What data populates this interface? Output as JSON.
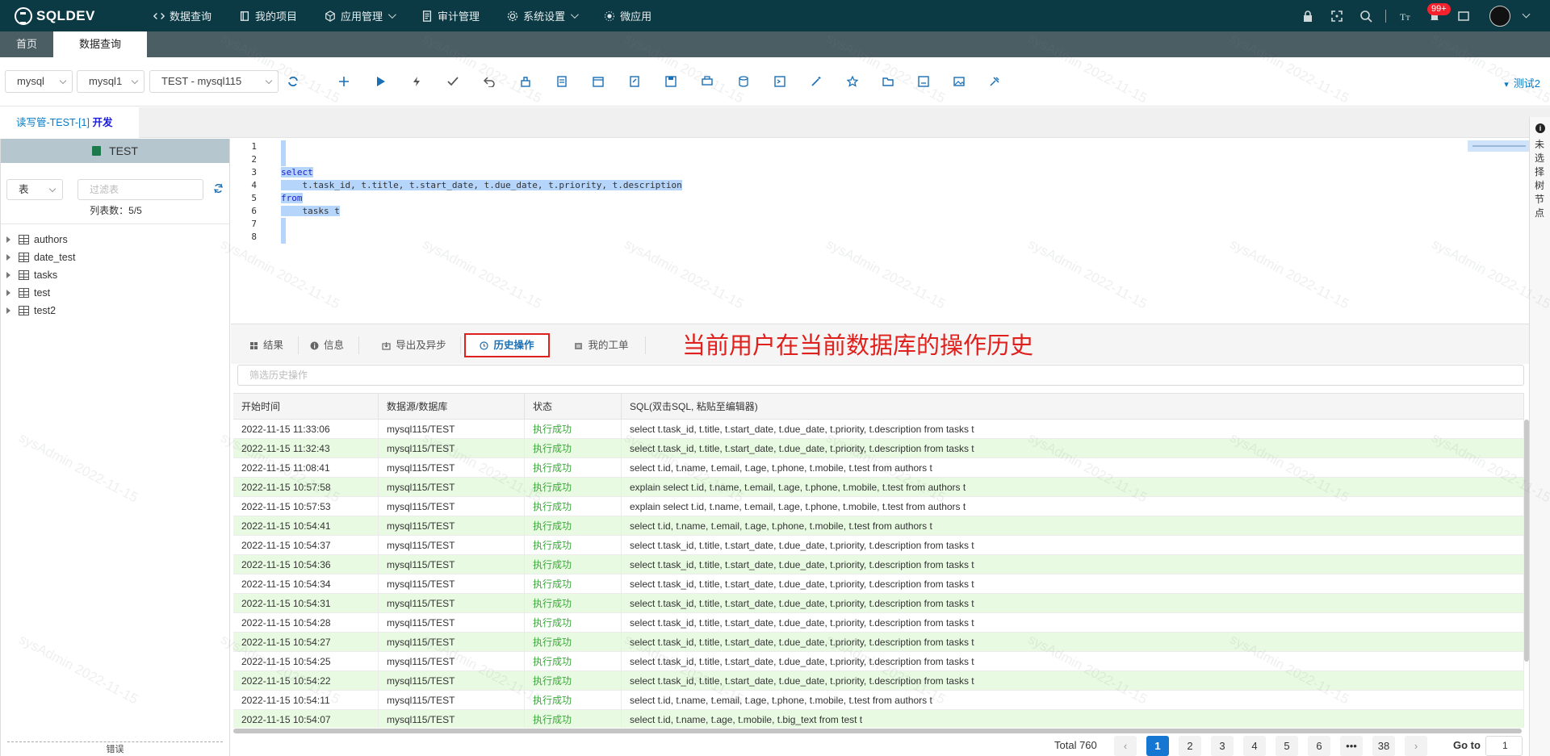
{
  "app": {
    "logo": "SQLDEV"
  },
  "nav": [
    {
      "label": "数据查询",
      "icon": "code-icon",
      "dropdown": false
    },
    {
      "label": "我的项目",
      "icon": "book-icon",
      "dropdown": false
    },
    {
      "label": "应用管理",
      "icon": "cube-icon",
      "dropdown": true
    },
    {
      "label": "审计管理",
      "icon": "document-icon",
      "dropdown": false
    },
    {
      "label": "系统设置",
      "icon": "gear-icon",
      "dropdown": true
    },
    {
      "label": "微应用",
      "icon": "sun-icon",
      "dropdown": false
    }
  ],
  "header_right": {
    "badge": "99+"
  },
  "page_tabs": [
    "首页",
    "数据查询"
  ],
  "toolbar": {
    "db_type": "mysql",
    "datasource": "mysql1",
    "connection": "TEST - mysql115",
    "user": "测试2"
  },
  "conn_tab": {
    "name": "读写管-TEST-[1]",
    "env": "开发"
  },
  "left_panel": {
    "db_name": "TEST",
    "kind": "表",
    "filter_placeholder": "过滤表",
    "count": "列表数：5/5",
    "tables": [
      "authors",
      "date_test",
      "tasks",
      "test",
      "test2"
    ],
    "footer": "错误"
  },
  "editor": {
    "lines": [
      {
        "num": "1",
        "text": ""
      },
      {
        "num": "2",
        "text": ""
      },
      {
        "num": "3",
        "text": "select"
      },
      {
        "num": "4",
        "text": "    t.task_id, t.title, t.start_date, t.due_date, t.priority, t.description"
      },
      {
        "num": "5",
        "text": "from"
      },
      {
        "num": "6",
        "text": "    tasks t"
      },
      {
        "num": "7",
        "text": ""
      },
      {
        "num": "8",
        "text": ""
      }
    ]
  },
  "side_strip": {
    "text": "未选择树节点"
  },
  "result_tabs": [
    {
      "label": "结果",
      "icon": "grid-icon"
    },
    {
      "label": "信息",
      "icon": "info-icon"
    },
    {
      "label": "导出及异步",
      "icon": "export-icon"
    },
    {
      "label": "历史操作",
      "icon": "clock-icon",
      "active": true
    },
    {
      "label": "我的工单",
      "icon": "ticket-icon"
    }
  ],
  "annotation": "当前用户在当前数据库的操作历史",
  "history": {
    "search_placeholder": "筛选历史操作",
    "columns": [
      "开始时间",
      "数据源/数据库",
      "状态",
      "SQL(双击SQL, 粘贴至编辑器)"
    ],
    "rows": [
      [
        "2022-11-15 11:33:06",
        "mysql115/TEST",
        "执行成功",
        "select t.task_id, t.title, t.start_date, t.due_date, t.priority, t.description from tasks t"
      ],
      [
        "2022-11-15 11:32:43",
        "mysql115/TEST",
        "执行成功",
        "select t.task_id, t.title, t.start_date, t.due_date, t.priority, t.description from tasks t"
      ],
      [
        "2022-11-15 11:08:41",
        "mysql115/TEST",
        "执行成功",
        "select t.id, t.name, t.email, t.age, t.phone, t.mobile, t.test from authors t"
      ],
      [
        "2022-11-15 10:57:58",
        "mysql115/TEST",
        "执行成功",
        "explain select t.id, t.name, t.email, t.age, t.phone, t.mobile, t.test from authors t"
      ],
      [
        "2022-11-15 10:57:53",
        "mysql115/TEST",
        "执行成功",
        "explain select t.id, t.name, t.email, t.age, t.phone, t.mobile, t.test from authors t"
      ],
      [
        "2022-11-15 10:54:41",
        "mysql115/TEST",
        "执行成功",
        "select t.id, t.name, t.email, t.age, t.phone, t.mobile, t.test from authors t"
      ],
      [
        "2022-11-15 10:54:37",
        "mysql115/TEST",
        "执行成功",
        "select t.task_id, t.title, t.start_date, t.due_date, t.priority, t.description from tasks t"
      ],
      [
        "2022-11-15 10:54:36",
        "mysql115/TEST",
        "执行成功",
        "select t.task_id, t.title, t.start_date, t.due_date, t.priority, t.description from tasks t"
      ],
      [
        "2022-11-15 10:54:34",
        "mysql115/TEST",
        "执行成功",
        "select t.task_id, t.title, t.start_date, t.due_date, t.priority, t.description from tasks t"
      ],
      [
        "2022-11-15 10:54:31",
        "mysql115/TEST",
        "执行成功",
        "select t.task_id, t.title, t.start_date, t.due_date, t.priority, t.description from tasks t"
      ],
      [
        "2022-11-15 10:54:28",
        "mysql115/TEST",
        "执行成功",
        "select t.task_id, t.title, t.start_date, t.due_date, t.priority, t.description from tasks t"
      ],
      [
        "2022-11-15 10:54:27",
        "mysql115/TEST",
        "执行成功",
        "select t.task_id, t.title, t.start_date, t.due_date, t.priority, t.description from tasks t"
      ],
      [
        "2022-11-15 10:54:25",
        "mysql115/TEST",
        "执行成功",
        "select t.task_id, t.title, t.start_date, t.due_date, t.priority, t.description from tasks t"
      ],
      [
        "2022-11-15 10:54:22",
        "mysql115/TEST",
        "执行成功",
        "select t.task_id, t.title, t.start_date, t.due_date, t.priority, t.description from tasks t"
      ],
      [
        "2022-11-15 10:54:11",
        "mysql115/TEST",
        "执行成功",
        "select t.id, t.name, t.email, t.age, t.phone, t.mobile, t.test from authors t"
      ],
      [
        "2022-11-15 10:54:07",
        "mysql115/TEST",
        "执行成功",
        "select t.id, t.name, t.age, t.mobile, t.big_text from test t"
      ]
    ]
  },
  "pagination": {
    "total": "Total 760",
    "pages": [
      "1",
      "2",
      "3",
      "4",
      "5",
      "6",
      "•••",
      "38"
    ],
    "current": "1",
    "goto_label": "Go to",
    "goto_value": "1"
  },
  "watermark": "sysAdmin 2022-11-15",
  "colors": {
    "header": "#0c3a44",
    "accent": "#1677d2",
    "success": "#3aa83a",
    "annotation": "#e0201c"
  }
}
